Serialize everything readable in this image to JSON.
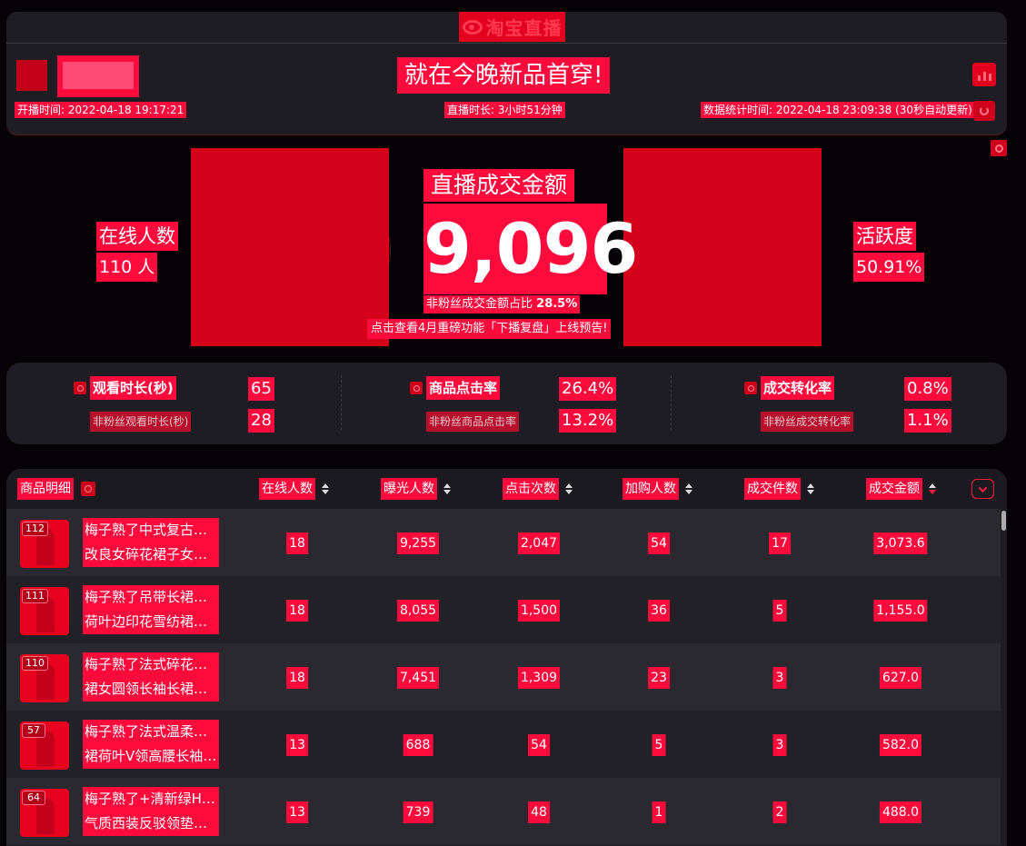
{
  "header": {
    "logo_text": "淘宝直播",
    "live_title": "就在今晚新品首穿!",
    "start_time": "开播时间: 2022-04-18 19:17:21",
    "duration": "直播时长: 3小时51分钟",
    "stats_time": "数据统计时间: 2022-04-18 23:09:38 (30秒自动更新)"
  },
  "hero": {
    "online_label": "在线人数",
    "online_value": "110 人",
    "gmv_label": "直播成交金额",
    "gmv_value": "9,096",
    "nonfan_ratio_label": "非粉丝成交金额占比",
    "nonfan_ratio_value": "28.5%",
    "preview_link": "点击查看4月重磅功能「下播复盘」上线预告!",
    "activity_label": "活跃度",
    "activity_value": "50.91%"
  },
  "kpis": [
    {
      "label": "观看时长(秒)",
      "value": "65",
      "sub_label": "非粉丝观看时长(秒)",
      "sub_value": "28"
    },
    {
      "label": "商品点击率",
      "value": "26.4%",
      "sub_label": "非粉丝商品点击率",
      "sub_value": "13.2%"
    },
    {
      "label": "成交转化率",
      "value": "0.8%",
      "sub_label": "非粉丝成交转化率",
      "sub_value": "1.1%"
    }
  ],
  "table": {
    "columns": [
      "商品明细",
      "在线人数",
      "曝光人数",
      "点击次数",
      "加购人数",
      "成交件数",
      "成交金额"
    ],
    "sorted_column": "成交金额",
    "rows": [
      {
        "rank": "112",
        "name_line1": "梅子熟了中式复古旗袍",
        "name_line2": "改良女碎花裙子女夏...",
        "online": "18",
        "exposure": "9,255",
        "clicks": "2,047",
        "carts": "54",
        "orders": "17",
        "amount": "3,073.6"
      },
      {
        "rank": "111",
        "name_line1": "梅子熟了吊带长裙仙女",
        "name_line2": "荷叶边印花雪纺裙子...",
        "online": "18",
        "exposure": "8,055",
        "clicks": "1,500",
        "carts": "36",
        "orders": "5",
        "amount": "1,155.0"
      },
      {
        "rank": "110",
        "name_line1": "梅子熟了法式碎花连衣",
        "name_line2": "裙女圆领长袖长裙高...",
        "online": "18",
        "exposure": "7,451",
        "clicks": "1,309",
        "carts": "23",
        "orders": "3",
        "amount": "627.0"
      },
      {
        "rank": "57",
        "name_line1": "梅子熟了法式温柔碎花",
        "name_line2": "裙荷叶V领高腰长袖连...",
        "online": "13",
        "exposure": "688",
        "clicks": "54",
        "carts": "5",
        "orders": "3",
        "amount": "582.0"
      },
      {
        "rank": "64",
        "name_line1": "梅子熟了+清新绿H版型",
        "name_line2": "气质西装反驳领垫肩...",
        "online": "13",
        "exposure": "739",
        "clicks": "48",
        "carts": "1",
        "orders": "2",
        "amount": "488.0"
      }
    ]
  },
  "colors": {
    "accent": "#ff0a3c",
    "panel": "#1e1d23",
    "background": "#050306"
  }
}
